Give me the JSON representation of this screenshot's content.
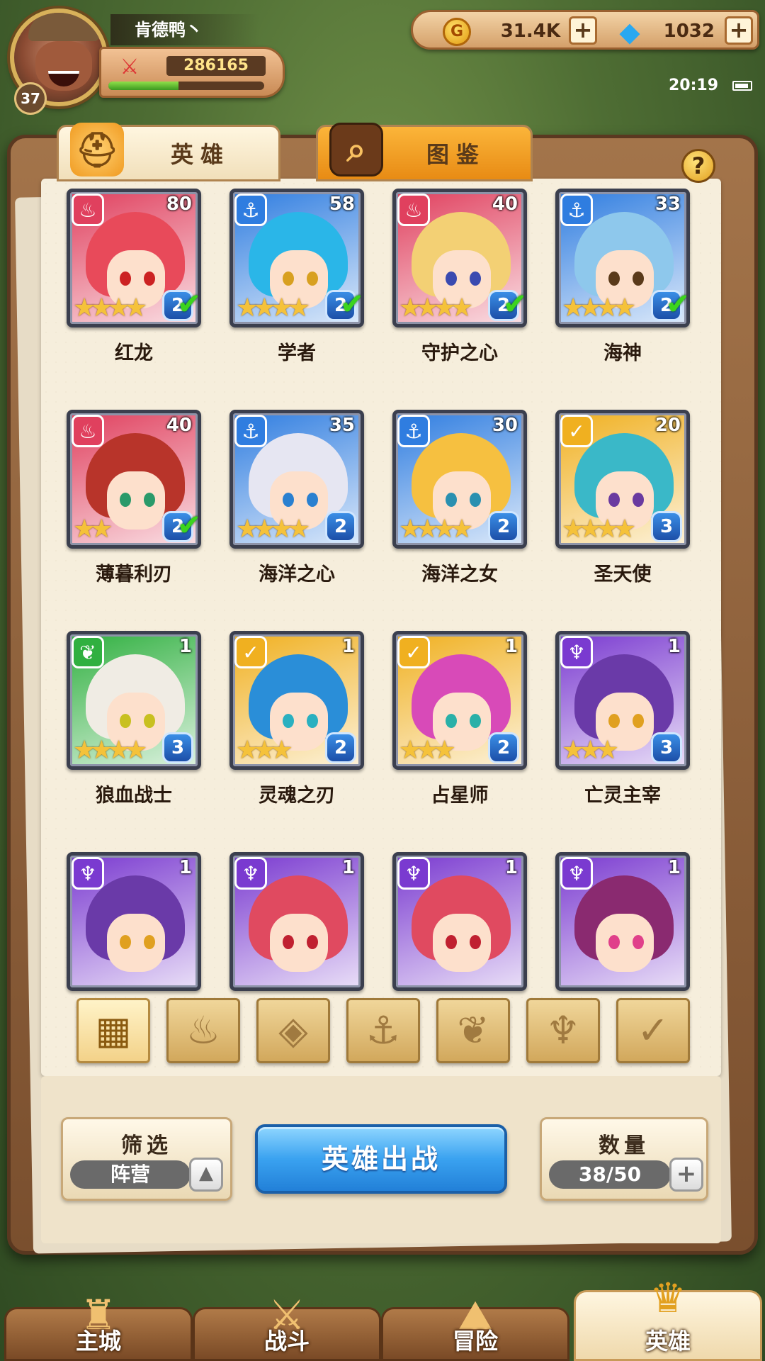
{
  "player": {
    "name": "肯德鸭丶",
    "level": "37",
    "power": "286165",
    "exp_fraction": 0.45
  },
  "currency": {
    "gold": "31.4K",
    "gems": "1032",
    "gold_icon_glyph": "G"
  },
  "status": {
    "time": "20:19"
  },
  "tabs": {
    "heroes": "英雄",
    "codex": "图鉴"
  },
  "help": "?",
  "colors": {
    "fire": "#e0405e",
    "water": "#2f7de0",
    "light": "#f0b020",
    "dark": "#7a3ad0",
    "beast": "#30b040"
  },
  "heroes": [
    {
      "name": "红龙",
      "level": "80",
      "faction": "fire",
      "faction_icon": "flame-icon",
      "stars": 4,
      "rank": "2",
      "checked": true,
      "hair": "#e84a5a",
      "eyes": "#c22"
    },
    {
      "name": "学者",
      "level": "58",
      "faction": "water",
      "faction_icon": "anchor-icon",
      "stars": 4,
      "rank": "2",
      "checked": true,
      "hair": "#2ab6e8",
      "eyes": "#d8a020"
    },
    {
      "name": "守护之心",
      "level": "40",
      "faction": "fire",
      "faction_icon": "flame-icon",
      "stars": 4,
      "rank": "2",
      "checked": true,
      "hair": "#f3d074",
      "eyes": "#3a4ab0"
    },
    {
      "name": "海神",
      "level": "33",
      "faction": "water",
      "faction_icon": "anchor-icon",
      "stars": 4,
      "rank": "2",
      "checked": true,
      "hair": "#8ec8ec",
      "eyes": "#5a3a1a"
    },
    {
      "name": "薄暮利刃",
      "level": "40",
      "faction": "fire",
      "faction_icon": "flame-icon",
      "stars": 2,
      "rank": "2",
      "checked": true,
      "hair": "#b8342a",
      "eyes": "#2a9a6a"
    },
    {
      "name": "海洋之心",
      "level": "35",
      "faction": "water",
      "faction_icon": "anchor-icon",
      "stars": 4,
      "rank": "2",
      "checked": false,
      "hair": "#e6e6f2",
      "eyes": "#2a80d0"
    },
    {
      "name": "海洋之女",
      "level": "30",
      "faction": "water",
      "faction_icon": "anchor-icon",
      "stars": 4,
      "rank": "2",
      "checked": false,
      "hair": "#f6c040",
      "eyes": "#2a90b0"
    },
    {
      "name": "圣天使",
      "level": "20",
      "faction": "light",
      "faction_icon": "wing-icon",
      "stars": 4,
      "rank": "3",
      "checked": false,
      "hair": "#3ab8c8",
      "eyes": "#6a3aa0"
    },
    {
      "name": "狼血战士",
      "level": "1",
      "faction": "beast",
      "faction_icon": "wolf-icon",
      "stars": 4,
      "rank": "3",
      "checked": false,
      "hair": "#f0ece4",
      "eyes": "#c8c020"
    },
    {
      "name": "灵魂之刃",
      "level": "1",
      "faction": "light",
      "faction_icon": "wing-icon",
      "stars": 3,
      "rank": "2",
      "checked": false,
      "hair": "#2a8ed8",
      "eyes": "#2ab0c0"
    },
    {
      "name": "占星师",
      "level": "1",
      "faction": "light",
      "faction_icon": "wing-icon",
      "stars": 3,
      "rank": "2",
      "checked": false,
      "hair": "#d84ab8",
      "eyes": "#2ab0a8"
    },
    {
      "name": "亡灵主宰",
      "level": "1",
      "faction": "dark",
      "faction_icon": "horn-icon",
      "stars": 3,
      "rank": "3",
      "checked": false,
      "hair": "#6a3aa8",
      "eyes": "#e0a020"
    },
    {
      "name": "",
      "level": "1",
      "faction": "dark",
      "faction_icon": "horn-icon",
      "stars": 0,
      "rank": "",
      "checked": false,
      "hair": "#6a3aa8",
      "eyes": "#e0a020"
    },
    {
      "name": "",
      "level": "1",
      "faction": "dark",
      "faction_icon": "horn-icon",
      "stars": 0,
      "rank": "",
      "checked": false,
      "hair": "#e04a60",
      "eyes": "#c02030"
    },
    {
      "name": "",
      "level": "1",
      "faction": "dark",
      "faction_icon": "horn-icon",
      "stars": 0,
      "rank": "",
      "checked": false,
      "hair": "#e04a60",
      "eyes": "#c02030"
    },
    {
      "name": "",
      "level": "1",
      "faction": "dark",
      "faction_icon": "horn-icon",
      "stars": 0,
      "rank": "",
      "checked": false,
      "hair": "#8a2a70",
      "eyes": "#e0408a"
    }
  ],
  "filters": [
    {
      "name": "all-grid-icon",
      "glyph": "▦",
      "active": true
    },
    {
      "name": "flame-icon",
      "glyph": "♨",
      "active": false
    },
    {
      "name": "diamond-icon",
      "glyph": "◈",
      "active": false
    },
    {
      "name": "anchor-icon",
      "glyph": "⚓",
      "active": false
    },
    {
      "name": "wolf-icon",
      "glyph": "❦",
      "active": false
    },
    {
      "name": "horn-icon",
      "glyph": "♆",
      "active": false
    },
    {
      "name": "wing-icon",
      "glyph": "✓",
      "active": false
    }
  ],
  "controls": {
    "filter_title": "筛选",
    "filter_value": "阵营",
    "deploy": "英雄出战",
    "count_title": "数量",
    "count_value": "38/50",
    "count_fraction": 0.76
  },
  "nav": [
    {
      "label": "主城",
      "icon": "castle-icon",
      "glyph": "♜",
      "active": false
    },
    {
      "label": "战斗",
      "icon": "crossed-swords-icon",
      "glyph": "⚔",
      "active": false
    },
    {
      "label": "冒险",
      "icon": "map-scroll-icon",
      "glyph": "⛰",
      "active": false
    },
    {
      "label": "英雄",
      "icon": "hero-crest-icon",
      "glyph": "♛",
      "active": true
    }
  ]
}
